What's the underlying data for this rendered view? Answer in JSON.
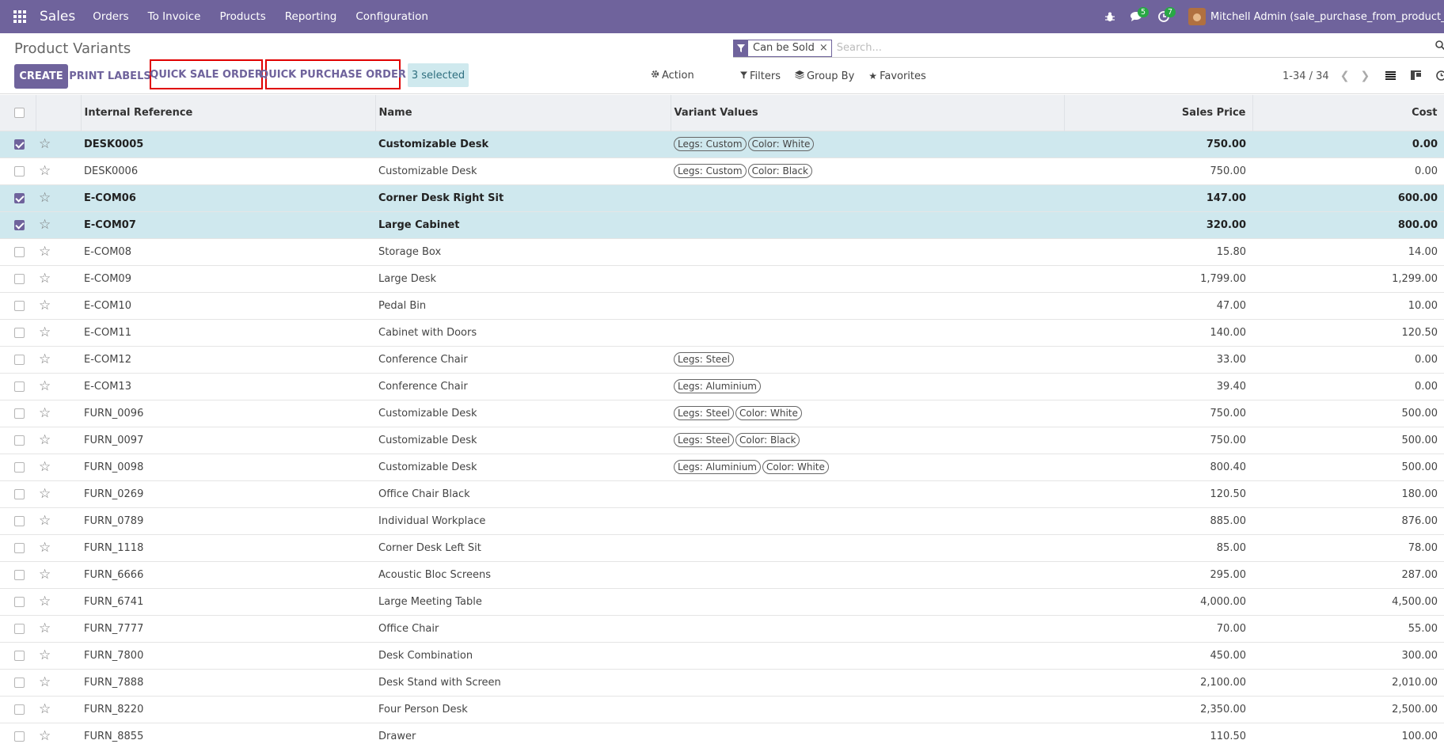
{
  "navbar": {
    "brand": "Sales",
    "menu": [
      "Orders",
      "To Invoice",
      "Products",
      "Reporting",
      "Configuration"
    ],
    "messages_badge": "5",
    "activities_badge": "7",
    "user": "Mitchell Admin (sale_purchase_from_product_test_"
  },
  "control": {
    "title": "Product Variants",
    "facet_label": "Can be Sold",
    "facet_close": "×",
    "search_placeholder": "Search...",
    "create": "CREATE",
    "print_labels": "PRINT LABELS",
    "quick_sale_order": "QUICK SALE ORDER",
    "quick_purchase_order": "QUICK PURCHASE ORDER",
    "selected": "3 selected",
    "action": "Action",
    "filters": "Filters",
    "group_by": "Group By",
    "favorites": "Favorites",
    "pager": "1-34 / 34"
  },
  "table": {
    "headers": {
      "internal_reference": "Internal Reference",
      "name": "Name",
      "variant_values": "Variant Values",
      "sales_price": "Sales Price",
      "cost": "Cost"
    },
    "rows": [
      {
        "ref": "DESK0005",
        "name": "Customizable Desk",
        "tags": [
          "Legs: Custom",
          "Color: White"
        ],
        "price": "750.00",
        "cost": "0.00",
        "selected": true
      },
      {
        "ref": "DESK0006",
        "name": "Customizable Desk",
        "tags": [
          "Legs: Custom",
          "Color: Black"
        ],
        "price": "750.00",
        "cost": "0.00",
        "selected": false
      },
      {
        "ref": "E-COM06",
        "name": "Corner Desk Right Sit",
        "tags": [],
        "price": "147.00",
        "cost": "600.00",
        "selected": true
      },
      {
        "ref": "E-COM07",
        "name": "Large Cabinet",
        "tags": [],
        "price": "320.00",
        "cost": "800.00",
        "selected": true
      },
      {
        "ref": "E-COM08",
        "name": "Storage Box",
        "tags": [],
        "price": "15.80",
        "cost": "14.00",
        "selected": false
      },
      {
        "ref": "E-COM09",
        "name": "Large Desk",
        "tags": [],
        "price": "1,799.00",
        "cost": "1,299.00",
        "selected": false
      },
      {
        "ref": "E-COM10",
        "name": "Pedal Bin",
        "tags": [],
        "price": "47.00",
        "cost": "10.00",
        "selected": false
      },
      {
        "ref": "E-COM11",
        "name": "Cabinet with Doors",
        "tags": [],
        "price": "140.00",
        "cost": "120.50",
        "selected": false
      },
      {
        "ref": "E-COM12",
        "name": "Conference Chair",
        "tags": [
          "Legs: Steel"
        ],
        "price": "33.00",
        "cost": "0.00",
        "selected": false
      },
      {
        "ref": "E-COM13",
        "name": "Conference Chair",
        "tags": [
          "Legs: Aluminium"
        ],
        "price": "39.40",
        "cost": "0.00",
        "selected": false
      },
      {
        "ref": "FURN_0096",
        "name": "Customizable Desk",
        "tags": [
          "Legs: Steel",
          "Color: White"
        ],
        "price": "750.00",
        "cost": "500.00",
        "selected": false
      },
      {
        "ref": "FURN_0097",
        "name": "Customizable Desk",
        "tags": [
          "Legs: Steel",
          "Color: Black"
        ],
        "price": "750.00",
        "cost": "500.00",
        "selected": false
      },
      {
        "ref": "FURN_0098",
        "name": "Customizable Desk",
        "tags": [
          "Legs: Aluminium",
          "Color: White"
        ],
        "price": "800.40",
        "cost": "500.00",
        "selected": false
      },
      {
        "ref": "FURN_0269",
        "name": "Office Chair Black",
        "tags": [],
        "price": "120.50",
        "cost": "180.00",
        "selected": false
      },
      {
        "ref": "FURN_0789",
        "name": "Individual Workplace",
        "tags": [],
        "price": "885.00",
        "cost": "876.00",
        "selected": false
      },
      {
        "ref": "FURN_1118",
        "name": "Corner Desk Left Sit",
        "tags": [],
        "price": "85.00",
        "cost": "78.00",
        "selected": false
      },
      {
        "ref": "FURN_6666",
        "name": "Acoustic Bloc Screens",
        "tags": [],
        "price": "295.00",
        "cost": "287.00",
        "selected": false
      },
      {
        "ref": "FURN_6741",
        "name": "Large Meeting Table",
        "tags": [],
        "price": "4,000.00",
        "cost": "4,500.00",
        "selected": false
      },
      {
        "ref": "FURN_7777",
        "name": "Office Chair",
        "tags": [],
        "price": "70.00",
        "cost": "55.00",
        "selected": false
      },
      {
        "ref": "FURN_7800",
        "name": "Desk Combination",
        "tags": [],
        "price": "450.00",
        "cost": "300.00",
        "selected": false
      },
      {
        "ref": "FURN_7888",
        "name": "Desk Stand with Screen",
        "tags": [],
        "price": "2,100.00",
        "cost": "2,010.00",
        "selected": false
      },
      {
        "ref": "FURN_8220",
        "name": "Four Person Desk",
        "tags": [],
        "price": "2,350.00",
        "cost": "2,500.00",
        "selected": false
      },
      {
        "ref": "FURN_8855",
        "name": "Drawer",
        "tags": [],
        "price": "110.50",
        "cost": "100.00",
        "selected": false
      }
    ]
  },
  "colors": {
    "brand": "#6f639c",
    "selected_row": "#cfe8ee",
    "highlight_border": "#e00000",
    "badge": "#28a745"
  }
}
